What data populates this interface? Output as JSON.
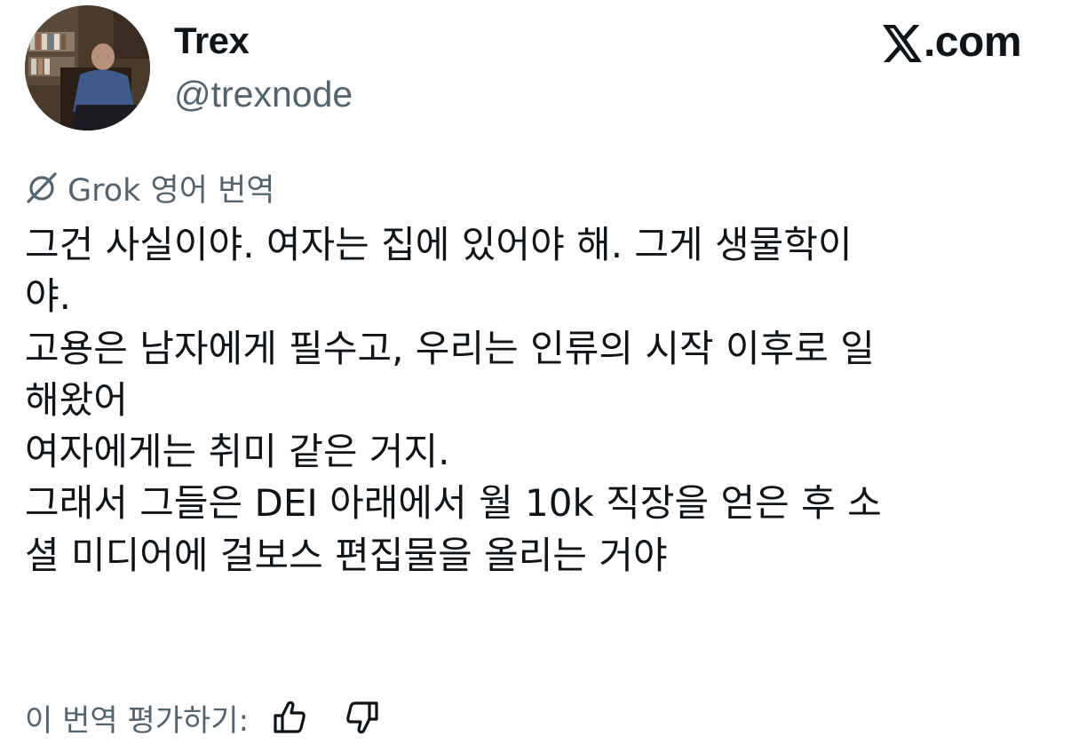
{
  "author": {
    "display_name": "Trex",
    "handle": "@trexnode",
    "avatar_icon": "user-avatar-photo"
  },
  "brand": {
    "label": ".com",
    "logo_icon": "x-logo-icon"
  },
  "translation": {
    "icon": "grok-icon",
    "label": "Grok 영어 번역"
  },
  "tweet": {
    "lines": [
      "그건 사실이야. 여자는 집에 있어야 해. 그게 생물학이",
      "야.",
      "고용은 남자에게 필수고, 우리는 인류의 시작 이후로 일",
      "해왔어",
      "여자에게는 취미 같은 거지.",
      "그래서 그들은 DEI 아래에서 월 10k 직장을 얻은 후 소",
      "셜 미디어에 걸보스 편집물을 올리는 거야"
    ]
  },
  "rating": {
    "label": "이 번역 평가하기:",
    "thumbs_up_icon": "thumbs-up-icon",
    "thumbs_down_icon": "thumbs-down-icon"
  },
  "colors": {
    "text_primary": "#0f1419",
    "text_secondary": "#536471",
    "background": "#ffffff"
  }
}
